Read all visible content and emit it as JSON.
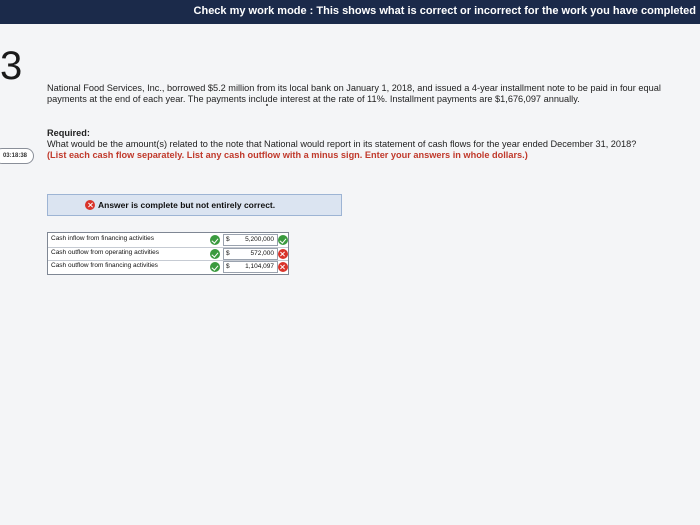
{
  "header": {
    "mode_text": "Check my work mode : This shows what is correct or incorrect for the work you have completed"
  },
  "question": {
    "number": "3",
    "timer": "03:18:38",
    "problem_text": "National Food Services, Inc., borrowed $5.2 million from its local bank on January 1, 2018, and issued a 4-year installment note to be paid in four equal payments at the end of each year. The payments include interest at the rate of 11%. Installment payments are $1,676,097 annually.",
    "required_label": "Required:",
    "question_text": "What would be the amount(s) related to the note that National would report in its statement of cash flows for the year ended December 31, 2018?",
    "instruction_text": "(List each cash flow separately. List any cash outflow with a minus sign. Enter your answers in whole dollars.)"
  },
  "answer": {
    "banner_text": "Answer is complete but not entirely correct.",
    "banner_icon": "cross-circle-icon",
    "rows": [
      {
        "label": "Cash inflow from financing activities",
        "label_status": "correct",
        "currency": "$",
        "value": "5,200,000",
        "value_status": "correct"
      },
      {
        "label": "Cash outflow from operating activities",
        "label_status": "correct",
        "currency": "$",
        "value": "572,000",
        "value_status": "incorrect"
      },
      {
        "label": "Cash outflow from financing activities",
        "label_status": "correct",
        "currency": "$",
        "value": "1,104,097",
        "value_status": "incorrect"
      }
    ]
  },
  "colors": {
    "header_bg": "#1b2a4a",
    "correct": "#3a9a3e",
    "incorrect": "#d9342b",
    "instruction": "#c0392b",
    "banner_bg": "#dbe4f1"
  }
}
